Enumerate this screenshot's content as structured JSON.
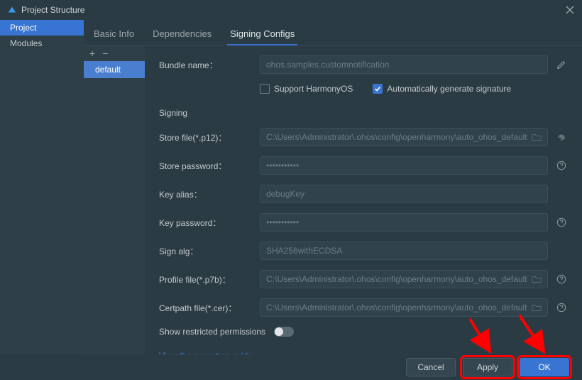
{
  "title": "Project Structure",
  "sidebar": {
    "items": [
      {
        "label": "Project",
        "selected": true
      },
      {
        "label": "Modules",
        "selected": false
      }
    ]
  },
  "tabs": [
    {
      "label": "Basic Info",
      "active": false
    },
    {
      "label": "Dependencies",
      "active": false
    },
    {
      "label": "Signing Configs",
      "active": true
    }
  ],
  "configs": {
    "items": [
      {
        "label": "default",
        "selected": true
      }
    ]
  },
  "form": {
    "bundle_name_label": "Bundle name：",
    "bundle_name_value": "ohos.samples.customnotification",
    "support_harmony_label": "Support HarmonyOS",
    "support_harmony_checked": false,
    "auto_sign_label": "Automatically generate signature",
    "auto_sign_checked": true,
    "signing_heading": "Signing",
    "store_file_label": "Store file(*.p12)：",
    "store_file_value": "C:\\Users\\Administrator\\.ohos\\config\\openharmony\\auto_ohos_default",
    "store_password_label": "Store password：",
    "store_password_value": "•••••••••••",
    "key_alias_label": "Key alias：",
    "key_alias_value": "debugKey",
    "key_password_label": "Key password：",
    "key_password_value": "•••••••••••",
    "sign_alg_label": "Sign alg：",
    "sign_alg_value": "SHA256withECDSA",
    "profile_file_label": "Profile file(*.p7b)：",
    "profile_file_value": "C:\\Users\\Administrator\\.ohos\\config\\openharmony\\auto_ohos_default",
    "certpath_label": "Certpath file(*.cer)：",
    "certpath_value": "C:\\Users\\Administrator\\.ohos\\config\\openharmony\\auto_ohos_default",
    "show_restricted_label": "Show restricted permissions",
    "show_restricted_on": false,
    "guide_link": "View the operation guide"
  },
  "buttons": {
    "cancel": "Cancel",
    "apply": "Apply",
    "ok": "OK"
  }
}
